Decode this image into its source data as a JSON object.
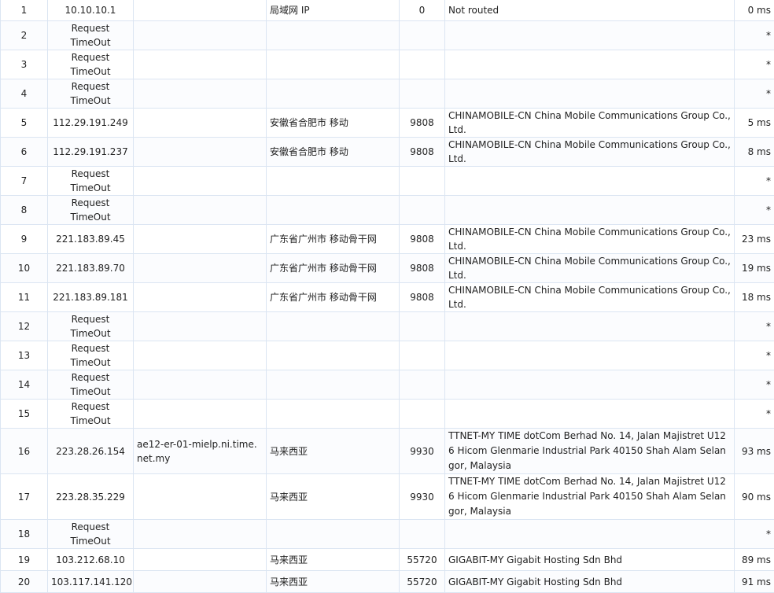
{
  "rows": [
    {
      "hop": "1",
      "ip": "10.10.10.1",
      "host": "",
      "location": "局域网 IP",
      "asn": "0",
      "org": "Not routed",
      "rtt": "0 ms"
    },
    {
      "hop": "2",
      "ip": "Request TimeOut",
      "host": "",
      "location": "",
      "asn": "",
      "org": "",
      "rtt": "*"
    },
    {
      "hop": "3",
      "ip": "Request TimeOut",
      "host": "",
      "location": "",
      "asn": "",
      "org": "",
      "rtt": "*"
    },
    {
      "hop": "4",
      "ip": "Request TimeOut",
      "host": "",
      "location": "",
      "asn": "",
      "org": "",
      "rtt": "*"
    },
    {
      "hop": "5",
      "ip": "112.29.191.249",
      "host": "",
      "location": "安徽省合肥市 移动",
      "asn": "9808",
      "org": "CHINAMOBILE-CN China Mobile Communications Group Co., Ltd.",
      "rtt": "5 ms"
    },
    {
      "hop": "6",
      "ip": "112.29.191.237",
      "host": "",
      "location": "安徽省合肥市 移动",
      "asn": "9808",
      "org": "CHINAMOBILE-CN China Mobile Communications Group Co., Ltd.",
      "rtt": "8 ms"
    },
    {
      "hop": "7",
      "ip": "Request TimeOut",
      "host": "",
      "location": "",
      "asn": "",
      "org": "",
      "rtt": "*"
    },
    {
      "hop": "8",
      "ip": "Request TimeOut",
      "host": "",
      "location": "",
      "asn": "",
      "org": "",
      "rtt": "*"
    },
    {
      "hop": "9",
      "ip": "221.183.89.45",
      "host": "",
      "location": "广东省广州市 移动骨干网",
      "asn": "9808",
      "org": "CHINAMOBILE-CN China Mobile Communications Group Co., Ltd.",
      "rtt": "23 ms"
    },
    {
      "hop": "10",
      "ip": "221.183.89.70",
      "host": "",
      "location": "广东省广州市 移动骨干网",
      "asn": "9808",
      "org": "CHINAMOBILE-CN China Mobile Communications Group Co., Ltd.",
      "rtt": "19 ms"
    },
    {
      "hop": "11",
      "ip": "221.183.89.181",
      "host": "",
      "location": "广东省广州市 移动骨干网",
      "asn": "9808",
      "org": "CHINAMOBILE-CN China Mobile Communications Group Co., Ltd.",
      "rtt": "18 ms"
    },
    {
      "hop": "12",
      "ip": "Request TimeOut",
      "host": "",
      "location": "",
      "asn": "",
      "org": "",
      "rtt": "*"
    },
    {
      "hop": "13",
      "ip": "Request TimeOut",
      "host": "",
      "location": "",
      "asn": "",
      "org": "",
      "rtt": "*"
    },
    {
      "hop": "14",
      "ip": "Request TimeOut",
      "host": "",
      "location": "",
      "asn": "",
      "org": "",
      "rtt": "*"
    },
    {
      "hop": "15",
      "ip": "Request TimeOut",
      "host": "",
      "location": "",
      "asn": "",
      "org": "",
      "rtt": "*"
    },
    {
      "hop": "16",
      "ip": "223.28.26.154",
      "host": "ae12-er-01-mielp.ni.time.net.my",
      "location": "马来西亚",
      "asn": "9930",
      "org": "TTNET-MY TIME dotCom Berhad No. 14, Jalan Majistret U126 Hicom Glenmarie Industrial Park 40150 Shah Alam Selangor, Malaysia",
      "rtt": "93 ms"
    },
    {
      "hop": "17",
      "ip": "223.28.35.229",
      "host": "",
      "location": "马来西亚",
      "asn": "9930",
      "org": "TTNET-MY TIME dotCom Berhad No. 14, Jalan Majistret U126 Hicom Glenmarie Industrial Park 40150 Shah Alam Selangor, Malaysia",
      "rtt": "90 ms"
    },
    {
      "hop": "18",
      "ip": "Request TimeOut",
      "host": "",
      "location": "",
      "asn": "",
      "org": "",
      "rtt": "*"
    },
    {
      "hop": "19",
      "ip": "103.212.68.10",
      "host": "",
      "location": "马来西亚",
      "asn": "55720",
      "org": "GIGABIT-MY Gigabit Hosting Sdn Bhd",
      "rtt": "89 ms"
    },
    {
      "hop": "20",
      "ip": "103.117.141.120",
      "host": "",
      "location": "马来西亚",
      "asn": "55720",
      "org": "GIGABIT-MY Gigabit Hosting Sdn Bhd",
      "rtt": "91 ms"
    }
  ]
}
